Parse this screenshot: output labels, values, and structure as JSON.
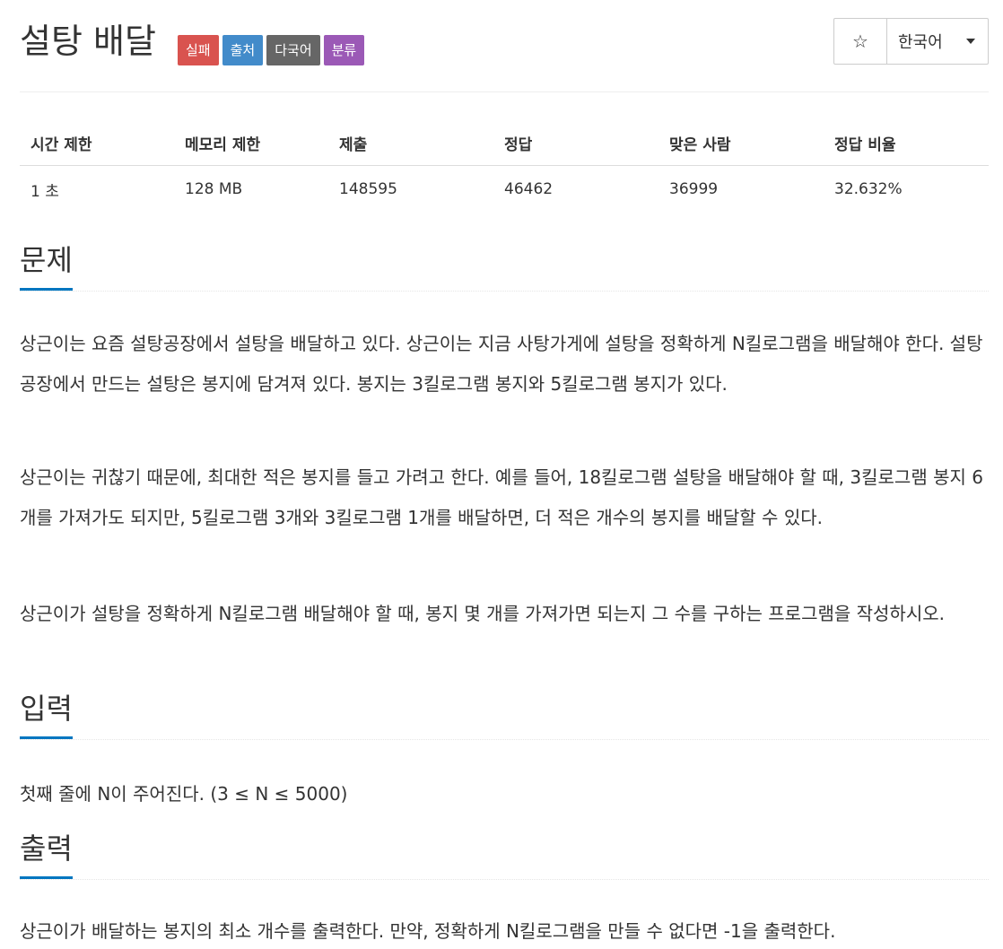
{
  "problem": {
    "title": "설탕 배달",
    "labels": [
      "실패",
      "출처",
      "다국어",
      "분류"
    ],
    "star_icon": "star-icon",
    "language": "한국어"
  },
  "info_table": {
    "headers": [
      "시간 제한",
      "메모리 제한",
      "제출",
      "정답",
      "맞은 사람",
      "정답 비율"
    ],
    "values": [
      "1 초",
      "128 MB",
      "148595",
      "46462",
      "36999",
      "32.632%"
    ]
  },
  "sections": {
    "description_title": "문제",
    "description": [
      "상근이는 요즘 설탕공장에서 설탕을 배달하고 있다. 상근이는 지금 사탕가게에 설탕을 정확하게 N킬로그램을 배달해야 한다. 설탕공장에서 만드는 설탕은 봉지에 담겨져 있다. 봉지는 3킬로그램 봉지와 5킬로그램 봉지가 있다.",
      "상근이는 귀찮기 때문에, 최대한 적은 봉지를 들고 가려고 한다. 예를 들어, 18킬로그램 설탕을 배달해야 할 때, 3킬로그램 봉지 6개를 가져가도 되지만, 5킬로그램 3개와 3킬로그램 1개를 배달하면, 더 적은 개수의 봉지를 배달할 수 있다.",
      "상근이가 설탕을 정확하게 N킬로그램 배달해야 할 때, 봉지 몇 개를 가져가면 되는지 그 수를 구하는 프로그램을 작성하시오."
    ],
    "input_title": "입력",
    "input": "첫째 줄에 N이 주어진다. (3 ≤ N ≤ 5000)",
    "output_title": "출력",
    "output": "상근이가 배달하는 봉지의 최소 개수를 출력한다. 만약, 정확하게 N킬로그램을 만들 수 없다면 -1을 출력한다."
  }
}
